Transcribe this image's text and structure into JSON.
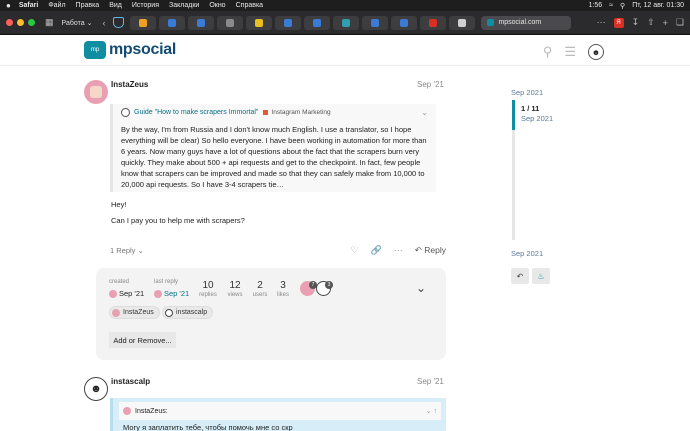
{
  "menubar": {
    "apple": "",
    "items": [
      "Safari",
      "Файл",
      "Правка",
      "Вид",
      "История",
      "Закладки",
      "Окно",
      "Справка"
    ],
    "clock": "Пт, 12 авг. 01:30",
    "battery": "1:56"
  },
  "toolbar": {
    "tab_group": "Работа",
    "url": "mpsocial.com",
    "tab_colors": [
      "#f0a020",
      "#3a7bd5",
      "#3a7bd5",
      "#8a8a8a",
      "#e8c020",
      "#3a7bd5",
      "#3a7bd5",
      "#2f9fb0",
      "#3a7bd5",
      "#3a7bd5",
      "#d93025",
      "#d0d0d0"
    ]
  },
  "header": {
    "logo_text": "mpsocial",
    "logo_bubble": "mp"
  },
  "post1": {
    "username": "InstaZeus",
    "date": "Sep '21",
    "quote": {
      "topic": "Guide \"How to make scrapers Immortal\"",
      "category": "Instagram Marketing",
      "body": "By the way, I'm from Russia and I don't know much English. I use a translator, so I hope everything will be clear) So hello everyone. I have been working in automation for more than 6 years. Now many guys have a lot of questions about the fact that the scrapers burn very quickly. They make about 500 + api requests and get to the checkpoint. In fact, few people know that scrapers can be improved and made so that they can safely make from 10,000 to 20,000 api requests. So I have 3-4 scrapers tie…"
    },
    "line1": "Hey!",
    "line2": "Can I pay you to help me with scrapers?",
    "replies": "1 Reply",
    "reply_label": "Reply"
  },
  "topic_map": {
    "created_label": "created",
    "created_date": "Sep '21",
    "last_reply_label": "last reply",
    "last_reply_date": "Sep '21",
    "stats": [
      {
        "num": "10",
        "label": "replies"
      },
      {
        "num": "12",
        "label": "views"
      },
      {
        "num": "2",
        "label": "users"
      },
      {
        "num": "3",
        "label": "likes"
      }
    ],
    "participant_counts": [
      "7",
      "3"
    ],
    "participants": [
      "InstaZeus",
      "instascalp"
    ],
    "add_remove": "Add or Remove..."
  },
  "post2": {
    "username": "instascalp",
    "date": "Sep '21",
    "quote_user": "InstaZeus:",
    "quote_text": "Могу я заплатить тебе, чтобы помочь мне со скр"
  },
  "timeline": {
    "top_date": "Sep 2021",
    "count": "1 / 11",
    "count_date": "Sep 2021",
    "bottom_date": "Sep 2021"
  }
}
